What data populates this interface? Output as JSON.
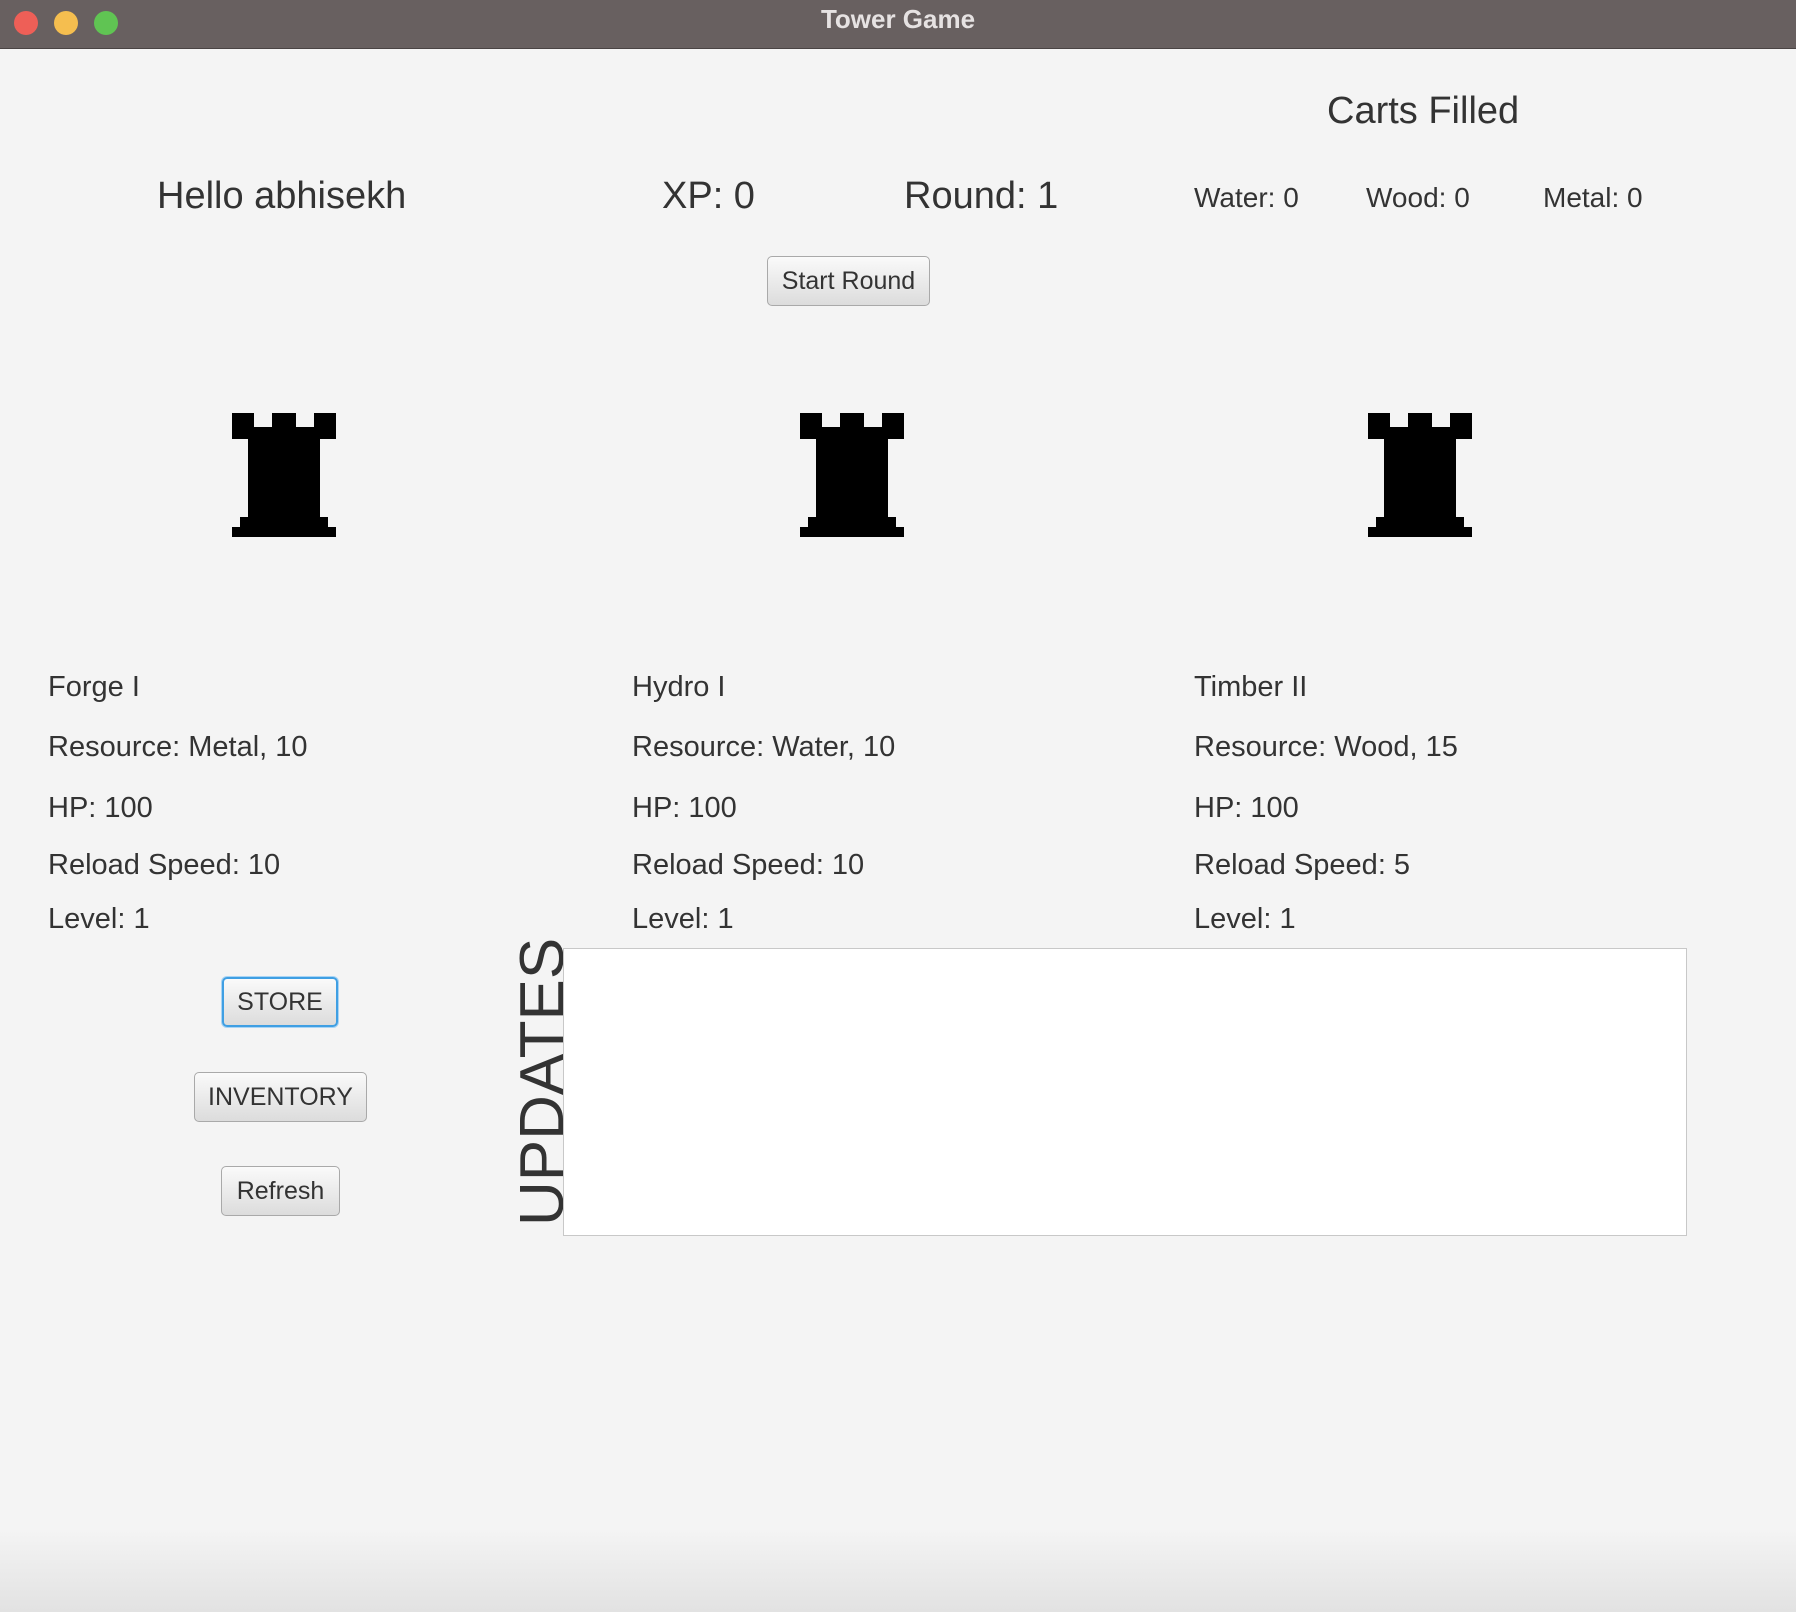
{
  "window": {
    "title": "Tower Game"
  },
  "header": {
    "greeting": "Hello abhisekh",
    "xp": "XP: 0",
    "round": "Round: 1",
    "start_round_label": "Start Round"
  },
  "carts": {
    "title": "Carts Filled",
    "water": "Water: 0",
    "wood": "Wood: 0",
    "metal": "Metal: 0"
  },
  "towers": [
    {
      "icon": "rook-tower-icon",
      "name": "Forge I",
      "resource": "Resource: Metal, 10",
      "hp": "HP: 100",
      "reload": "Reload Speed: 10",
      "level": "Level: 1"
    },
    {
      "icon": "rook-tower-icon",
      "name": "Hydro I",
      "resource": "Resource: Water, 10",
      "hp": "HP: 100",
      "reload": "Reload Speed: 10",
      "level": "Level: 1"
    },
    {
      "icon": "rook-tower-icon",
      "name": "Timber II",
      "resource": "Resource: Wood, 15",
      "hp": "HP: 100",
      "reload": "Reload Speed: 5",
      "level": "Level: 1"
    }
  ],
  "actions": {
    "store_label": "STORE",
    "inventory_label": "INVENTORY",
    "refresh_label": "Refresh"
  },
  "updates": {
    "label": "UPDATES",
    "content": ""
  },
  "colors": {
    "titlebar": "#686060",
    "background": "#f4f4f4",
    "focus_ring": "#3f9fe3",
    "tower_icon": "#000000"
  }
}
